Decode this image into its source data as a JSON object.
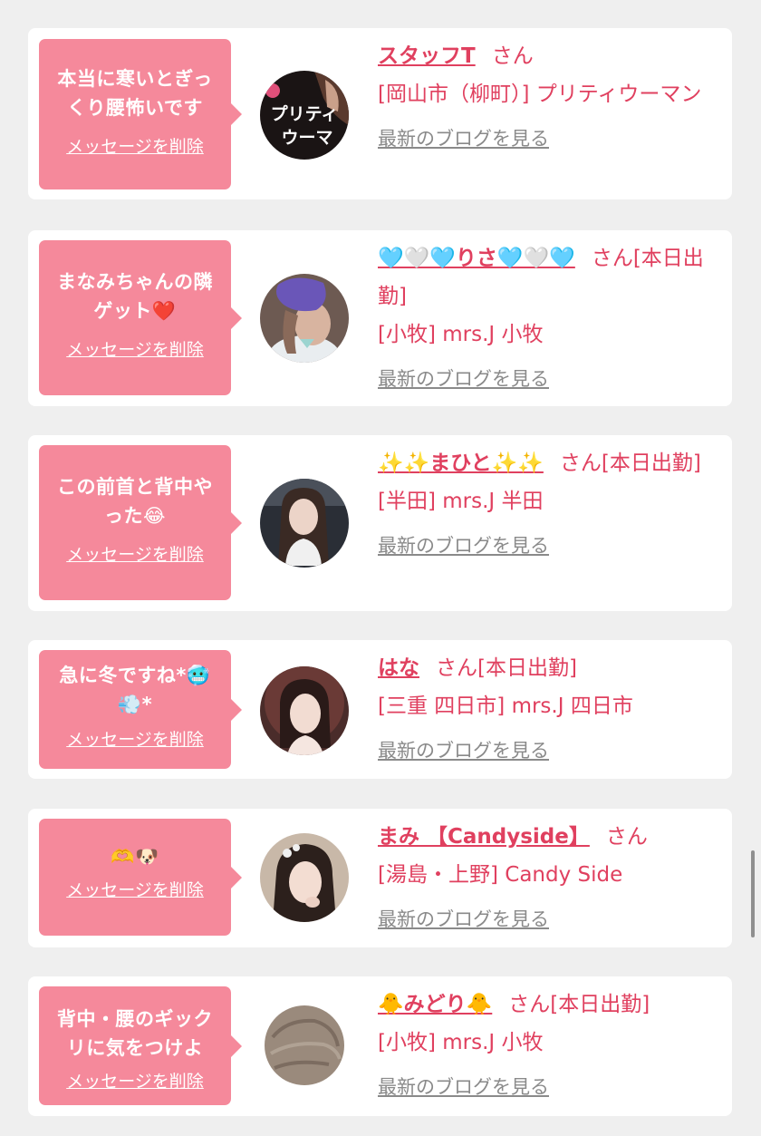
{
  "common": {
    "delete_label": "メッセージを削除",
    "blog_label": "最新のブログを見る",
    "san_label": "さん"
  },
  "items": [
    {
      "message": "本当に寒いとぎっくり腰怖いです",
      "name": "スタッフT",
      "suffix": "",
      "shop": "[岡山市（柳町）] プリティウーマン",
      "avatar_icon": "pretty-woman-logo"
    },
    {
      "message": "まなみちゃんの隣ゲット❤️",
      "name": "🩵🤍🩵りさ🩵🤍🩵",
      "suffix": "[本日出勤]",
      "shop": "[小牧] mrs.J 小牧",
      "avatar_icon": "profile-photo"
    },
    {
      "message": "この前首と背中やった😂",
      "name": "✨✨まひと✨✨",
      "suffix": "[本日出勤]",
      "shop": "[半田] mrs.J 半田",
      "avatar_icon": "profile-photo"
    },
    {
      "message": "急に冬ですね*🥶💨*",
      "name": "はな",
      "suffix": "[本日出勤]",
      "shop": "[三重 四日市] mrs.J 四日市",
      "avatar_icon": "profile-photo"
    },
    {
      "message": "🫶🐶",
      "name": "まみ 【Candyside】",
      "suffix": "",
      "shop": "[湯島・上野] Candy Side",
      "avatar_icon": "profile-photo"
    },
    {
      "message": "背中・腰のギックリに気をつけよ",
      "name": "🐥みどり🐥",
      "suffix": "[本日出勤]",
      "shop": "[小牧] mrs.J 小牧",
      "avatar_icon": "profile-photo"
    }
  ]
}
